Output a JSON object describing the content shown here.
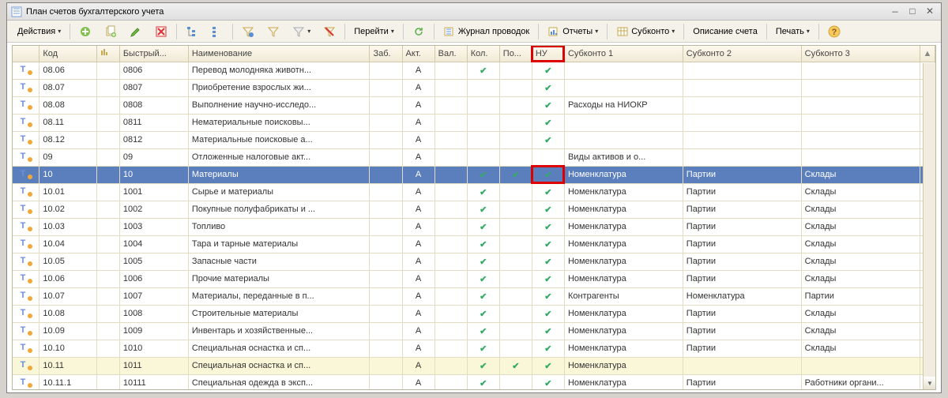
{
  "window": {
    "title": "План счетов бухгалтерского учета"
  },
  "toolbar": {
    "actions": "Действия",
    "go": "Перейти",
    "journal": "Журнал проводок",
    "reports": "Отчеты",
    "subkonto": "Субконто",
    "descr": "Описание счета",
    "print": "Печать"
  },
  "headers": {
    "c0": "",
    "c1": "Код",
    "c2": "",
    "c3": "Быстрый...",
    "c4": "Наименование",
    "c5": "Заб.",
    "c6": "Акт.",
    "c7": "Вал.",
    "c8": "Кол.",
    "c9": "По...",
    "c10": "НУ",
    "c11": "Субконто 1",
    "c12": "Субконто 2",
    "c13": "Субконто 3"
  },
  "rows": [
    {
      "code": "08.06",
      "quick": "0806",
      "name": "Перевод молодняка животн...",
      "act": "А",
      "val": "",
      "qty": "✔",
      "po": "",
      "nu": "✔",
      "s1": "",
      "s2": "",
      "s3": ""
    },
    {
      "code": "08.07",
      "quick": "0807",
      "name": "Приобретение взрослых жи...",
      "act": "А",
      "val": "",
      "qty": "",
      "po": "",
      "nu": "✔",
      "s1": "",
      "s2": "",
      "s3": ""
    },
    {
      "code": "08.08",
      "quick": "0808",
      "name": "Выполнение научно-исследо...",
      "act": "А",
      "val": "",
      "qty": "",
      "po": "",
      "nu": "✔",
      "s1": "Расходы на НИОКР",
      "s2": "",
      "s3": ""
    },
    {
      "code": "08.11",
      "quick": "0811",
      "name": "Нематериальные поисковы...",
      "act": "А",
      "val": "",
      "qty": "",
      "po": "",
      "nu": "✔",
      "s1": "",
      "s2": "",
      "s3": ""
    },
    {
      "code": "08.12",
      "quick": "0812",
      "name": "Материальные поисковые а...",
      "act": "А",
      "val": "",
      "qty": "",
      "po": "",
      "nu": "✔",
      "s1": "",
      "s2": "",
      "s3": ""
    },
    {
      "code": "09",
      "quick": "09",
      "name": "Отложенные налоговые акт...",
      "act": "А",
      "val": "",
      "qty": "",
      "po": "",
      "nu": "",
      "s1": "Виды активов и о...",
      "s2": "",
      "s3": ""
    },
    {
      "code": "10",
      "quick": "10",
      "name": "Материалы",
      "act": "А",
      "val": "",
      "qty": "✔",
      "po": "✔",
      "nu": "✔",
      "s1": "Номенклатура",
      "s2": "Партии",
      "s3": "Склады",
      "selected": true,
      "nu_red": true
    },
    {
      "code": "10.01",
      "quick": "1001",
      "name": "Сырье и материалы",
      "act": "А",
      "val": "",
      "qty": "✔",
      "po": "",
      "nu": "✔",
      "s1": "Номенклатура",
      "s2": "Партии",
      "s3": "Склады"
    },
    {
      "code": "10.02",
      "quick": "1002",
      "name": "Покупные полуфабрикаты и ...",
      "act": "А",
      "val": "",
      "qty": "✔",
      "po": "",
      "nu": "✔",
      "s1": "Номенклатура",
      "s2": "Партии",
      "s3": "Склады"
    },
    {
      "code": "10.03",
      "quick": "1003",
      "name": "Топливо",
      "act": "А",
      "val": "",
      "qty": "✔",
      "po": "",
      "nu": "✔",
      "s1": "Номенклатура",
      "s2": "Партии",
      "s3": "Склады"
    },
    {
      "code": "10.04",
      "quick": "1004",
      "name": "Тара и тарные материалы",
      "act": "А",
      "val": "",
      "qty": "✔",
      "po": "",
      "nu": "✔",
      "s1": "Номенклатура",
      "s2": "Партии",
      "s3": "Склады"
    },
    {
      "code": "10.05",
      "quick": "1005",
      "name": "Запасные части",
      "act": "А",
      "val": "",
      "qty": "✔",
      "po": "",
      "nu": "✔",
      "s1": "Номенклатура",
      "s2": "Партии",
      "s3": "Склады"
    },
    {
      "code": "10.06",
      "quick": "1006",
      "name": "Прочие материалы",
      "act": "А",
      "val": "",
      "qty": "✔",
      "po": "",
      "nu": "✔",
      "s1": "Номенклатура",
      "s2": "Партии",
      "s3": "Склады"
    },
    {
      "code": "10.07",
      "quick": "1007",
      "name": "Материалы, переданные в п...",
      "act": "А",
      "val": "",
      "qty": "✔",
      "po": "",
      "nu": "✔",
      "s1": "Контрагенты",
      "s2": "Номенклатура",
      "s3": "Партии"
    },
    {
      "code": "10.08",
      "quick": "1008",
      "name": "Строительные материалы",
      "act": "А",
      "val": "",
      "qty": "✔",
      "po": "",
      "nu": "✔",
      "s1": "Номенклатура",
      "s2": "Партии",
      "s3": "Склады"
    },
    {
      "code": "10.09",
      "quick": "1009",
      "name": "Инвентарь и хозяйственные...",
      "act": "А",
      "val": "",
      "qty": "✔",
      "po": "",
      "nu": "✔",
      "s1": "Номенклатура",
      "s2": "Партии",
      "s3": "Склады"
    },
    {
      "code": "10.10",
      "quick": "1010",
      "name": "Специальная оснастка и сп...",
      "act": "А",
      "val": "",
      "qty": "✔",
      "po": "",
      "nu": "✔",
      "s1": "Номенклатура",
      "s2": "Партии",
      "s3": "Склады"
    },
    {
      "code": "10.11",
      "quick": "1011",
      "name": "Специальная оснастка и сп...",
      "act": "А",
      "val": "",
      "qty": "✔",
      "po": "✔",
      "nu": "✔",
      "s1": "Номенклатура",
      "s2": "",
      "s3": "",
      "highlight": true
    },
    {
      "code": "10.11.1",
      "quick": "10111",
      "name": "Специальная одежда в эксп...",
      "act": "А",
      "val": "",
      "qty": "✔",
      "po": "",
      "nu": "✔",
      "s1": "Номенклатура",
      "s2": "Партии",
      "s3": "Работники органи..."
    }
  ]
}
